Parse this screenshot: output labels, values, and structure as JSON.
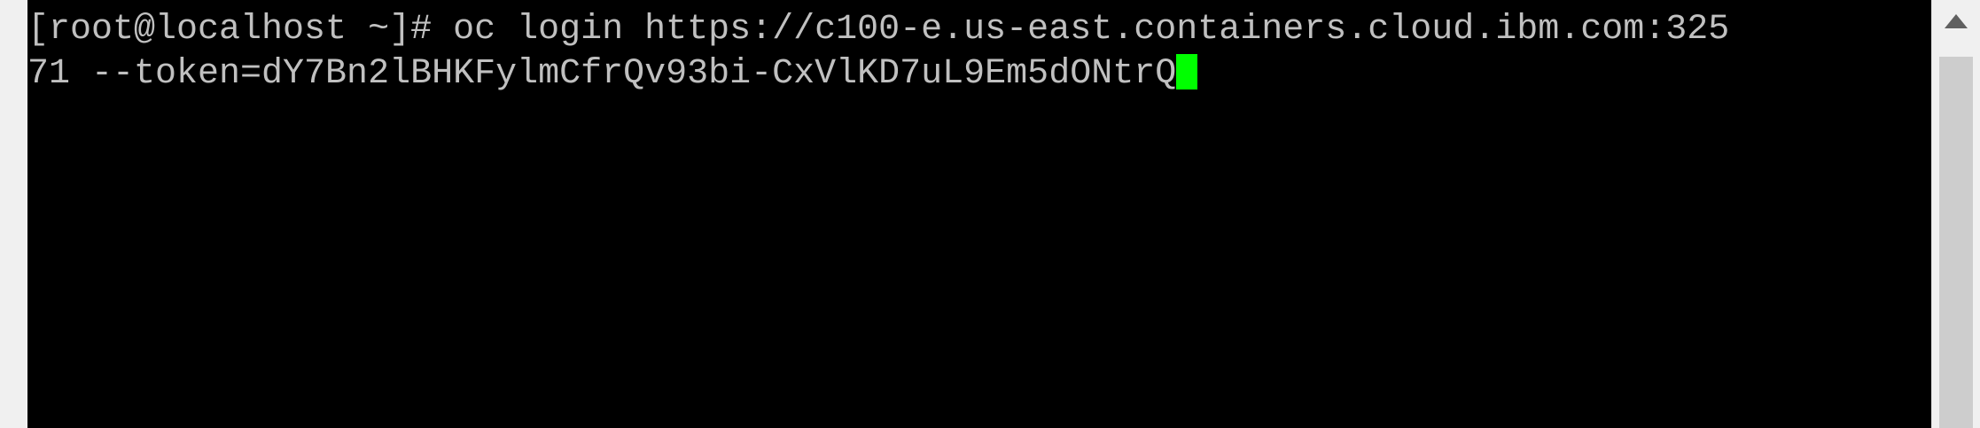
{
  "terminal": {
    "line1": "[root@localhost ~]# oc login https://c100-e.us-east.containers.cloud.ibm.com:325",
    "line2": "71 --token=dY7Bn2lBHKFylmCfrQv93bi-CxVlKD7uL9Em5dONtrQ"
  },
  "colors": {
    "terminal_background": "#000000",
    "terminal_text": "#c0c0c0",
    "cursor": "#00ff00",
    "window_chrome": "#f0f0f0"
  },
  "icons": {
    "scroll_up": "triangle-up-icon"
  }
}
